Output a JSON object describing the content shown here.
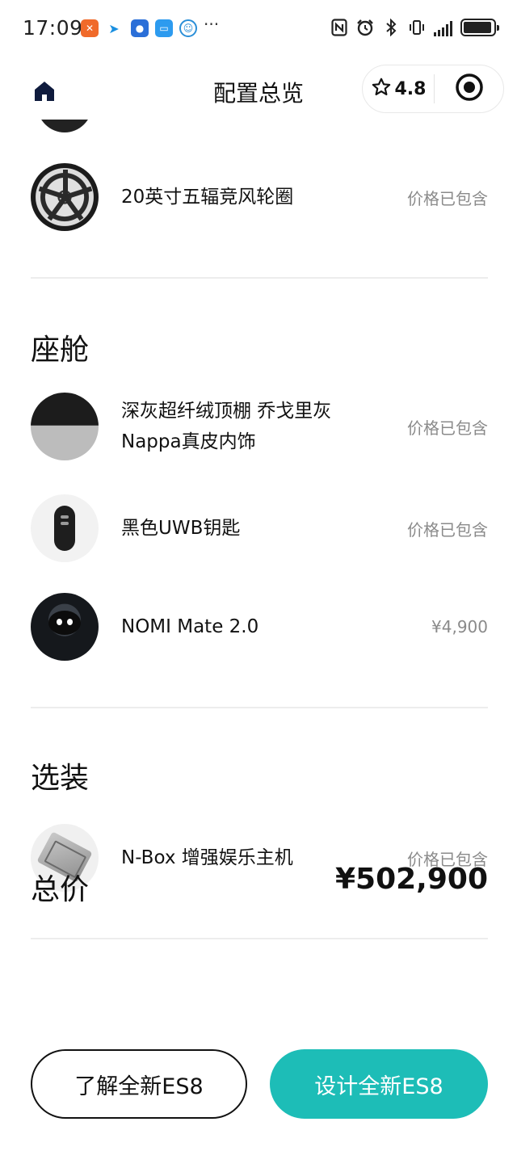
{
  "status_bar": {
    "time": "17:09",
    "more": "···",
    "notification_icons": [
      "app-orange-icon",
      "app-bird-icon",
      "app-blue-circle-icon",
      "chat-bubble-icon",
      "app-face-icon"
    ],
    "right_icons": [
      "nfc-icon",
      "alarm-icon",
      "bluetooth-icon",
      "vibrate-icon",
      "signal-icon",
      "battery-icon"
    ],
    "battery_level": 0.95
  },
  "header": {
    "title": "配置总览",
    "rating": "4.8"
  },
  "sections": {
    "cabin_title": "座舱",
    "options_title": "选装"
  },
  "items": [
    {
      "name": "20英寸五辐竞风轮圈",
      "price": "价格已包含"
    },
    {
      "name": "深灰超纤绒顶棚 乔戈里灰Nappa真皮内饰",
      "price": "价格已包含"
    },
    {
      "name": "黑色UWB钥匙",
      "price": "价格已包含"
    },
    {
      "name": "NOMI Mate 2.0",
      "price": "¥4,900"
    },
    {
      "name": "N-Box 增强娱乐主机",
      "price": "价格已包含"
    }
  ],
  "total": {
    "label": "总价",
    "value": "¥502,900"
  },
  "buttons": {
    "learn": "了解全新ES8",
    "design": "设计全新ES8"
  },
  "colors": {
    "accent": "#1dbdb7",
    "text": "#111111",
    "muted": "#8a8a8a",
    "divider": "#ededed"
  }
}
